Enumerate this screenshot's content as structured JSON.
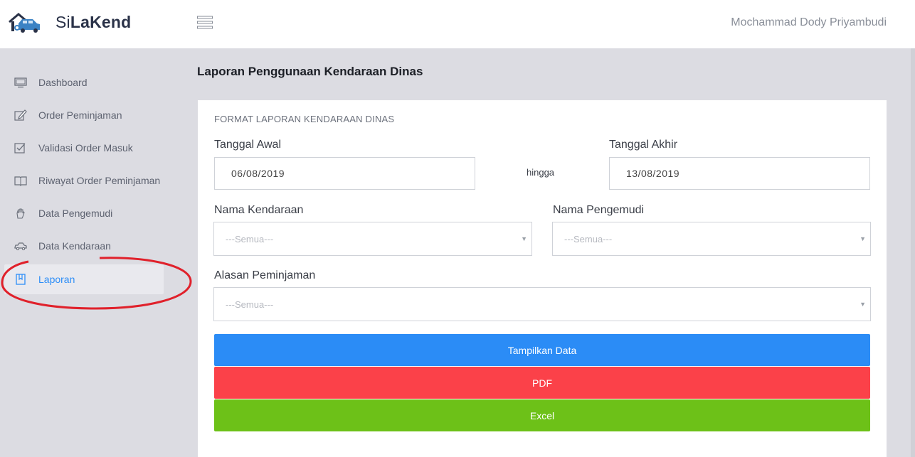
{
  "header": {
    "brand_prefix": "Si",
    "brand_bold": "LaKend",
    "user_name": "Mochammad Dody Priyambudi"
  },
  "sidebar": {
    "items": [
      {
        "label": "Dashboard",
        "icon": "monitor-icon"
      },
      {
        "label": "Order Peminjaman",
        "icon": "edit-icon"
      },
      {
        "label": "Validasi Order Masuk",
        "icon": "checkbox-icon"
      },
      {
        "label": "Riwayat Order Peminjaman",
        "icon": "book-icon"
      },
      {
        "label": "Data Pengemudi",
        "icon": "hand-icon"
      },
      {
        "label": "Data Kendaraan",
        "icon": "car-icon"
      },
      {
        "label": "Laporan",
        "icon": "report-icon",
        "active": true
      }
    ]
  },
  "main": {
    "page_title": "Laporan Penggunaan Kendaraan Dinas",
    "card_title": "FORMAT LAPORAN KENDARAAN DINAS",
    "tanggal_awal": {
      "label": "Tanggal Awal",
      "value": "06/08/2019"
    },
    "separator": "hingga",
    "tanggal_akhir": {
      "label": "Tanggal Akhir",
      "value": "13/08/2019"
    },
    "nama_kendaraan": {
      "label": "Nama Kendaraan",
      "selected": "---Semua---"
    },
    "nama_pengemudi": {
      "label": "Nama Pengemudi",
      "selected": "---Semua---"
    },
    "alasan_peminjaman": {
      "label": "Alasan Peminjaman",
      "selected": "---Semua---"
    },
    "buttons": {
      "show": "Tampilkan Data",
      "pdf": "PDF",
      "excel": "Excel"
    }
  },
  "colors": {
    "accent": "#2b8cf6",
    "danger": "#fb4149",
    "success": "#6dc118",
    "annotation": "#e0212b"
  }
}
